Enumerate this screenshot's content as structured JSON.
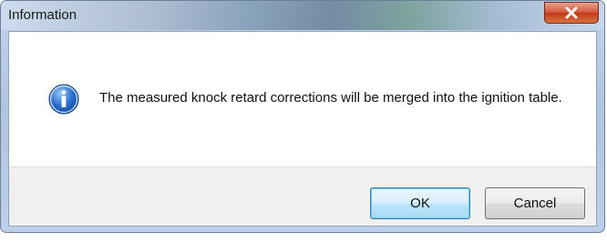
{
  "window": {
    "title": "Information",
    "close_icon": "close-icon"
  },
  "dialog": {
    "icon": "info-icon",
    "message": "The measured knock retard corrections will be merged into the ignition table."
  },
  "buttons": {
    "ok_label": "OK",
    "cancel_label": "Cancel"
  },
  "colors": {
    "close_button": "#c7452a",
    "info_icon": "#2a6fd0",
    "default_button_border": "#3c7fb1"
  }
}
